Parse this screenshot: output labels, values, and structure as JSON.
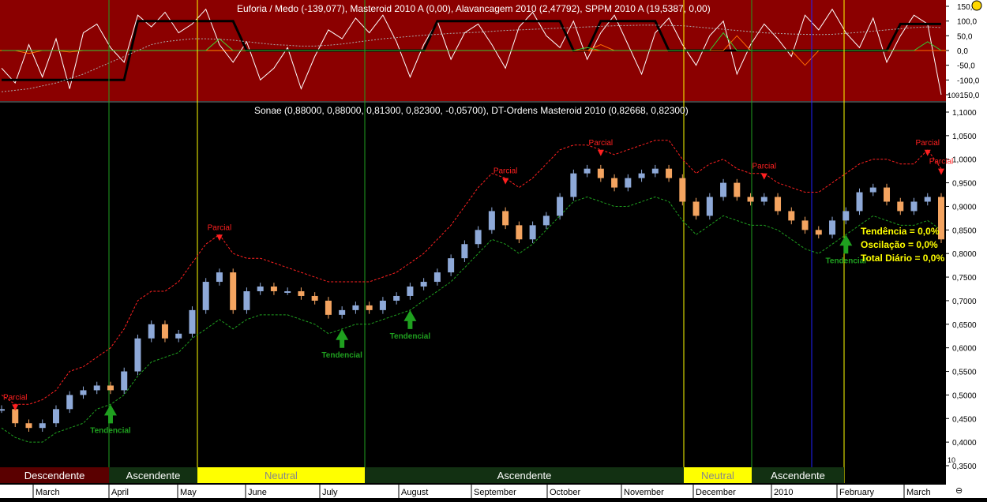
{
  "window": {
    "indicator_title": "Euforia / Medo (-139,077), Masteroid 2010 A (0,00), Alavancagem 2010 (2,47792), SPPM 2010 A (19,5387, 0,00)",
    "main_title": "Sonae (0,88000, 0,88000, 0,81300, 0,82300, -0,05700), DT-Ordens Masteroid 2010 (0,82668, 0,82300)",
    "stats": [
      "Tendência = 0,0%",
      "Oscilação = 0,0%",
      "Total Diário = 0,0%"
    ],
    "corner_icon": "close-circle-icon",
    "bottom_icon": "zoom-icon",
    "bottom_glyph": "⊖"
  },
  "colors": {
    "indicator_bg": "#8b0000",
    "chart_bg": "#000000",
    "candle_up": "#8ea9d8",
    "candle_down": "#f4a460",
    "band_upper": "#ff2020",
    "band_lower": "#1fa01f",
    "signal_red": "#ff2020",
    "signal_green": "#1fa01f",
    "neutral": "#ffff00"
  },
  "chart_data": [
    {
      "type": "line",
      "title": "Euforia / Medo (-139,077), Masteroid 2010 A (0,00), Alavancagem 2010 (2,47792), SPPM 2010 A (19,5387, 0,00)",
      "ylim": [
        -150,
        150
      ],
      "y_ticks": [
        "150,0",
        "100,0",
        "50,0",
        "0,0",
        "-50,0",
        "-100,0",
        "-150,0"
      ],
      "series": [
        {
          "name": "Euforia / Medo",
          "color": "#ffffff",
          "values": [
            -60,
            -110,
            20,
            -90,
            40,
            -130,
            60,
            90,
            10,
            -40,
            120,
            80,
            130,
            60,
            90,
            140,
            20,
            -40,
            30,
            -100,
            -60,
            10,
            -130,
            -20,
            70,
            40,
            110,
            60,
            120,
            30,
            -90,
            20,
            100,
            -30,
            60,
            90,
            20,
            -60,
            80,
            130,
            50,
            10,
            100,
            -30,
            60,
            120,
            20,
            -80,
            60,
            110,
            20,
            -50,
            50,
            100,
            -80,
            20,
            90,
            40,
            -20,
            120,
            70,
            140,
            60,
            10,
            110,
            -40,
            50,
            120,
            90,
            -150
          ]
        },
        {
          "name": "Masteroid 2010 A",
          "color": "#000000",
          "values": [
            -100,
            -100,
            -100,
            -100,
            -100,
            -100,
            -100,
            -100,
            -100,
            -100,
            100,
            100,
            100,
            100,
            100,
            100,
            100,
            100,
            0,
            0,
            0,
            0,
            0,
            0,
            0,
            0,
            0,
            0,
            0,
            0,
            0,
            0,
            100,
            100,
            100,
            100,
            100,
            100,
            100,
            100,
            100,
            100,
            0,
            0,
            100,
            100,
            100,
            100,
            100,
            0,
            0,
            0,
            0,
            0,
            0,
            0,
            0,
            0,
            0,
            0,
            0,
            0,
            0,
            0,
            0,
            0,
            90,
            90,
            90,
            90
          ]
        },
        {
          "name": "Alavancagem 2010",
          "color": "#ff6a00",
          "values": [
            0,
            0,
            -10,
            0,
            0,
            -5,
            0,
            0,
            0,
            0,
            0,
            0,
            0,
            0,
            0,
            0,
            40,
            0,
            0,
            0,
            0,
            0,
            0,
            0,
            0,
            0,
            0,
            0,
            0,
            0,
            0,
            0,
            0,
            0,
            0,
            0,
            0,
            0,
            0,
            0,
            0,
            0,
            0,
            0,
            20,
            0,
            0,
            0,
            0,
            0,
            0,
            0,
            0,
            0,
            50,
            0,
            0,
            0,
            0,
            -50,
            0,
            0,
            0,
            0,
            0,
            0,
            0,
            0,
            0,
            0
          ]
        },
        {
          "name": "SPPM 2010 A",
          "color": "#33cc33",
          "values": [
            0,
            0,
            0,
            0,
            0,
            0,
            0,
            0,
            0,
            0,
            0,
            0,
            0,
            0,
            0,
            0,
            40,
            0,
            0,
            0,
            0,
            0,
            0,
            0,
            0,
            0,
            0,
            0,
            0,
            0,
            0,
            0,
            0,
            0,
            0,
            0,
            0,
            0,
            0,
            0,
            0,
            0,
            0,
            10,
            0,
            0,
            0,
            0,
            0,
            0,
            0,
            0,
            0,
            60,
            0,
            0,
            0,
            0,
            0,
            0,
            0,
            0,
            0,
            0,
            0,
            0,
            0,
            0,
            30,
            0
          ]
        },
        {
          "name": "signal",
          "color": "#aaaaaa",
          "values": [
            -140,
            -135,
            -130,
            -120,
            -110,
            -95,
            -80,
            -60,
            -40,
            -20,
            0,
            20,
            30,
            35,
            40,
            40,
            38,
            35,
            30,
            25,
            20,
            18,
            15,
            15,
            18,
            22,
            28,
            34,
            40,
            44,
            48,
            52,
            55,
            58,
            60,
            62,
            65,
            68,
            70,
            72,
            74,
            76,
            78,
            80,
            82,
            84,
            85,
            86,
            86,
            85,
            84,
            80,
            76,
            72,
            68,
            64,
            60,
            58,
            56,
            55,
            54,
            55,
            58,
            62,
            66,
            70,
            74,
            78,
            80,
            78
          ]
        }
      ]
    },
    {
      "type": "line",
      "title": "Sonae (0,88000, 0,88000, 0,81300, 0,82300, -0,05700), DT-Ordens Masteroid 2010 (0,82668, 0,82300)",
      "x_labels": [
        "March",
        "April",
        "May",
        "June",
        "July",
        "August",
        "September",
        "October",
        "November",
        "December",
        "2010",
        "February",
        "March"
      ],
      "ylim": [
        0.35,
        1.1
      ],
      "y_ticks": [
        "1,1000",
        "1,0500",
        "1,0000",
        "0,9500",
        "0,9000",
        "0,8500",
        "0,8000",
        "0,7500",
        "0,7000",
        "0,6500",
        "0,6000",
        "0,5500",
        "0,5000",
        "0,4500",
        "0,4000",
        "0,3500"
      ],
      "series": [
        {
          "name": "price",
          "color": "#8ea9d8",
          "values": [
            0.47,
            0.44,
            0.43,
            0.44,
            0.47,
            0.5,
            0.51,
            0.52,
            0.51,
            0.55,
            0.62,
            0.65,
            0.62,
            0.63,
            0.68,
            0.74,
            0.76,
            0.68,
            0.72,
            0.73,
            0.72,
            0.72,
            0.71,
            0.7,
            0.67,
            0.68,
            0.69,
            0.68,
            0.7,
            0.71,
            0.73,
            0.74,
            0.76,
            0.79,
            0.82,
            0.85,
            0.89,
            0.86,
            0.83,
            0.86,
            0.88,
            0.92,
            0.97,
            0.98,
            0.96,
            0.94,
            0.96,
            0.97,
            0.98,
            0.96,
            0.91,
            0.88,
            0.92,
            0.95,
            0.92,
            0.91,
            0.92,
            0.89,
            0.87,
            0.85,
            0.84,
            0.87,
            0.89,
            0.93,
            0.94,
            0.91,
            0.89,
            0.91,
            0.92,
            0.83
          ]
        },
        {
          "name": "upper",
          "color": "#ff2020",
          "values": [
            0.5,
            0.48,
            0.48,
            0.49,
            0.51,
            0.55,
            0.56,
            0.58,
            0.6,
            0.64,
            0.7,
            0.72,
            0.72,
            0.74,
            0.78,
            0.82,
            0.84,
            0.8,
            0.79,
            0.79,
            0.78,
            0.77,
            0.76,
            0.75,
            0.74,
            0.74,
            0.74,
            0.74,
            0.75,
            0.76,
            0.78,
            0.8,
            0.83,
            0.86,
            0.9,
            0.94,
            0.97,
            0.96,
            0.94,
            0.96,
            0.99,
            1.02,
            1.03,
            1.03,
            1.02,
            1.01,
            1.02,
            1.03,
            1.04,
            1.04,
            1.0,
            0.97,
            0.99,
            1.0,
            0.98,
            0.97,
            0.97,
            0.95,
            0.94,
            0.93,
            0.93,
            0.95,
            0.97,
            0.99,
            1.0,
            1.0,
            0.99,
            0.99,
            1.02,
            0.98
          ]
        },
        {
          "name": "lower",
          "color": "#1fa01f",
          "values": [
            0.43,
            0.41,
            0.4,
            0.4,
            0.42,
            0.43,
            0.44,
            0.47,
            0.48,
            0.5,
            0.54,
            0.57,
            0.58,
            0.59,
            0.62,
            0.64,
            0.66,
            0.64,
            0.66,
            0.67,
            0.67,
            0.67,
            0.66,
            0.65,
            0.63,
            0.64,
            0.65,
            0.65,
            0.66,
            0.67,
            0.68,
            0.7,
            0.72,
            0.74,
            0.77,
            0.8,
            0.83,
            0.82,
            0.8,
            0.82,
            0.85,
            0.88,
            0.91,
            0.92,
            0.91,
            0.9,
            0.9,
            0.91,
            0.92,
            0.91,
            0.87,
            0.84,
            0.86,
            0.88,
            0.87,
            0.86,
            0.86,
            0.85,
            0.83,
            0.81,
            0.8,
            0.82,
            0.84,
            0.86,
            0.88,
            0.87,
            0.86,
            0.86,
            0.87,
            0.85
          ]
        }
      ],
      "annotations": [
        "Parcial",
        "Parcial",
        "Parcial",
        "Parcial",
        "Parcial",
        "Parcial",
        "Tendencial",
        "Tendencial",
        "Tendencial",
        "Tendencial",
        "Parcial"
      ],
      "regime_bar": [
        "Descendente",
        "Ascendente",
        "Neutral",
        "Ascendente",
        "Neutral",
        "Ascendente"
      ],
      "y_tick_extra": "10",
      "ind_y_tick_extra": "100"
    }
  ]
}
